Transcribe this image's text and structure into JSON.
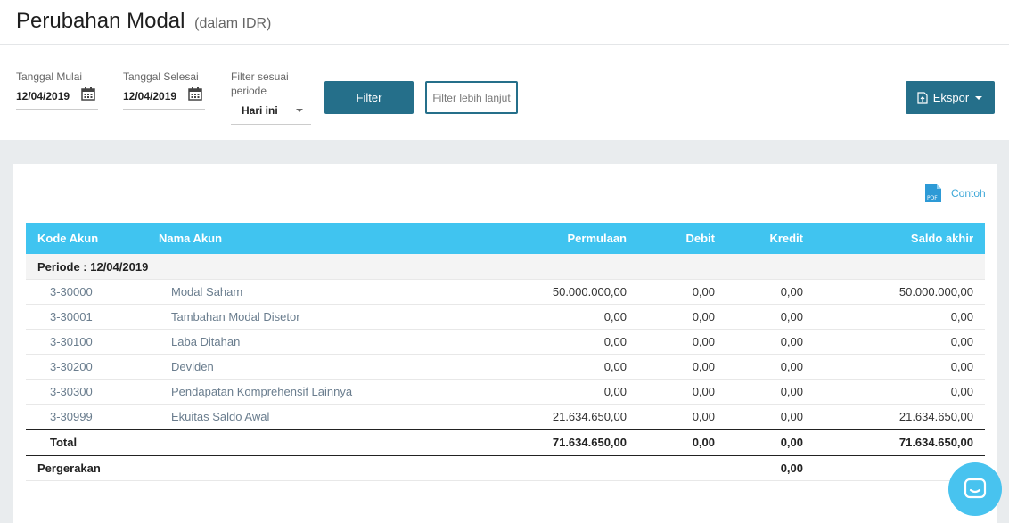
{
  "page": {
    "title": "Perubahan Modal",
    "subtitle": "(dalam IDR)"
  },
  "filters": {
    "start_label": "Tanggal Mulai",
    "start_value": "12/04/2019",
    "end_label": "Tanggal Selesai",
    "end_value": "12/04/2019",
    "period_label": "Filter sesuai periode",
    "period_value": "Hari ini",
    "filter_button": "Filter",
    "more_filter_button": "Filter lebih lanjut",
    "export_button": "Ekspor"
  },
  "sample_link": "Contoh",
  "sample_icon": "pdf-icon",
  "colors": {
    "primary": "#256f8a",
    "table_header": "#40c4f0",
    "link": "#3ea8d8"
  },
  "table": {
    "columns": [
      "Kode Akun",
      "Nama Akun",
      "Permulaan",
      "Debit",
      "Kredit",
      "Saldo akhir"
    ],
    "period": "Periode : 12/04/2019",
    "rows": [
      {
        "code": "3-30000",
        "name": "Modal Saham",
        "start": "50.000.000,00",
        "debit": "0,00",
        "credit": "0,00",
        "end": "50.000.000,00"
      },
      {
        "code": "3-30001",
        "name": "Tambahan Modal Disetor",
        "start": "0,00",
        "debit": "0,00",
        "credit": "0,00",
        "end": "0,00"
      },
      {
        "code": "3-30100",
        "name": "Laba Ditahan",
        "start": "0,00",
        "debit": "0,00",
        "credit": "0,00",
        "end": "0,00"
      },
      {
        "code": "3-30200",
        "name": "Deviden",
        "start": "0,00",
        "debit": "0,00",
        "credit": "0,00",
        "end": "0,00"
      },
      {
        "code": "3-30300",
        "name": "Pendapatan Komprehensif Lainnya",
        "start": "0,00",
        "debit": "0,00",
        "credit": "0,00",
        "end": "0,00"
      },
      {
        "code": "3-30999",
        "name": "Ekuitas Saldo Awal",
        "start": "21.634.650,00",
        "debit": "0,00",
        "credit": "0,00",
        "end": "21.634.650,00"
      }
    ],
    "total": {
      "label": "Total",
      "start": "71.634.650,00",
      "debit": "0,00",
      "credit": "0,00",
      "end": "71.634.650,00"
    },
    "movement": {
      "label": "Pergerakan",
      "credit": "0,00"
    }
  }
}
